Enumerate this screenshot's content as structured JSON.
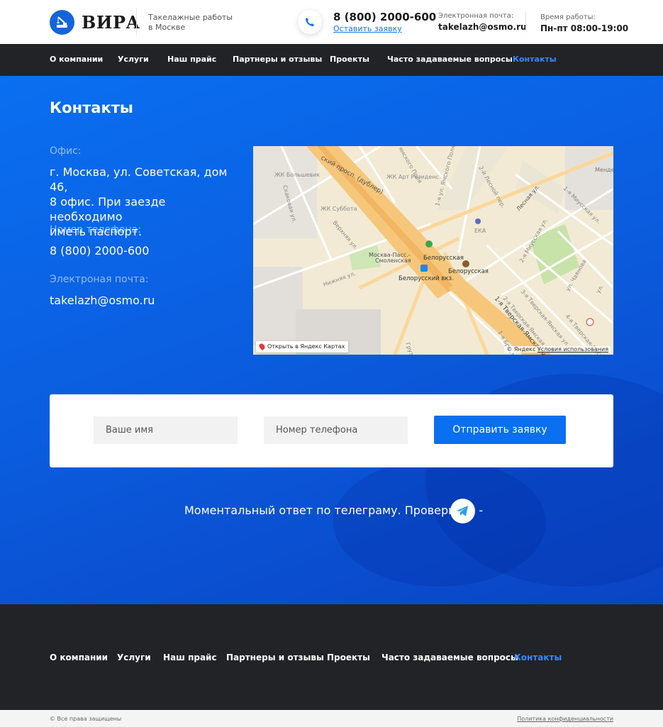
{
  "header": {
    "brand": "ВИРА",
    "tagline_line1": "Такелажные работы",
    "tagline_line2": "в Москве",
    "phone": "8 (800) 2000-600",
    "request_link": "Оставить заявку",
    "email_label": "Электронная почта:",
    "email": "takelazh@osmo.ru",
    "hours_label": "Время работы:",
    "hours": "Пн-пт 08:00-19:00"
  },
  "nav": {
    "items": [
      {
        "label": "О компании"
      },
      {
        "label": "Услуги"
      },
      {
        "label": "Наш прайс"
      },
      {
        "label": "Партнеры и отзывы"
      },
      {
        "label": "Проекты"
      },
      {
        "label": "Часто задаваемые вопросы"
      },
      {
        "label": "Контакты",
        "active": true
      }
    ]
  },
  "contacts": {
    "title": "Контакты",
    "office_label": "Офис:",
    "office_line1": "г. Москва, ул. Советская, дом 46,",
    "office_line2": "8 офис. При заезде необходимо",
    "office_line3": "иметь паспорт.",
    "phone_label": "Номер телефона:",
    "phone": "8 (800) 2000-600",
    "email_label": "Электроная почта:",
    "email": "takelazh@osmo.ru"
  },
  "map": {
    "open_link": "Открыть в Яндекс Картах",
    "copyright": "© Яндекс",
    "terms": "Условия использования",
    "labels": {
      "avenue": "ский просп. (дублер)",
      "bolshevik": "ЖК Большевик",
      "subbota": "ЖК Суббота",
      "art_residence": "ЖК Арт Резиденс",
      "yamskogo": "ямского Поля",
      "yamskogo1": "1-я ул. Ямского Поля",
      "lesnoy2": "2-й Лесной пер.",
      "lesnaya": "Лесная ул.",
      "miusskaya1": "1-я Миусская ул.",
      "miusskaya2": "2-я Миусская ул.",
      "skakovaya": "Скаковая ул.",
      "verkhnyaya": "Верхняя ул.",
      "nizhnyaya": "Нижняя ул.",
      "eka": "ЕКА",
      "mende": "Менде",
      "moskva_pass": "Москва-Пасс.-",
      "smolenskaya": "Смоленская",
      "belorusskaya_metro": "Белорусская",
      "belorusskaya2": "Белорусская",
      "belorussky_vokzal": "Белорусский вкз.",
      "tverskaya_yamskaya1": "1-я Тверская-Ямская ул.",
      "tverskaya_yamskaya2": "2-я Тверская-Ямская ул.",
      "tverskaya_yamskaya3": "3-я Тверская-Ямская ул.",
      "tverskaya_yamskaya4": "4-я Тверская-Ямская ул.",
      "brestskaya": "1-я Брестская ул.",
      "chayanova": "ул. Чаянова",
      "ul": "ул.",
      "gruzinsk": "Грузи"
    }
  },
  "form": {
    "name_placeholder": "Ваше имя",
    "phone_placeholder": "Номер телефона",
    "submit_label": "Отправить заявку"
  },
  "telegram": {
    "text": "Моментальный ответ по телеграму. Проверите? -"
  },
  "footer": {
    "copyright": "© Все права защищены",
    "privacy": "Политика конфиденциальности"
  },
  "colors": {
    "accent": "#0a6ff0",
    "nav_bg": "#222326",
    "active_link": "#2f8bff"
  }
}
